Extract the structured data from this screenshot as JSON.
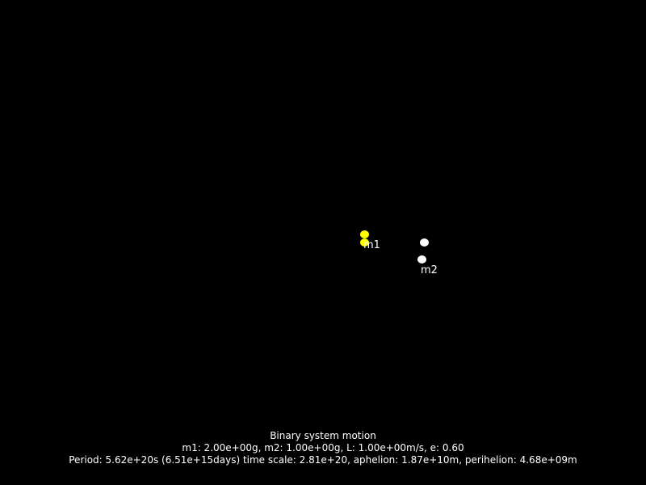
{
  "colors": {
    "background": "#000000",
    "m1": "#ffff00",
    "m2": "#ffffff",
    "text": "#ffffff"
  },
  "bodies": {
    "m1": {
      "label": "m1"
    },
    "m2": {
      "label": "m2"
    }
  },
  "info": {
    "title": "Binary system motion",
    "params": "m1: 2.00e+00g, m2: 1.00e+00g, L: 1.00e+00m/s, e: 0.60",
    "stats": "Period: 5.62e+20s (6.51e+15days) time scale: 2.81e+20, aphelion: 1.87e+10m, perihelion: 4.68e+09m"
  }
}
